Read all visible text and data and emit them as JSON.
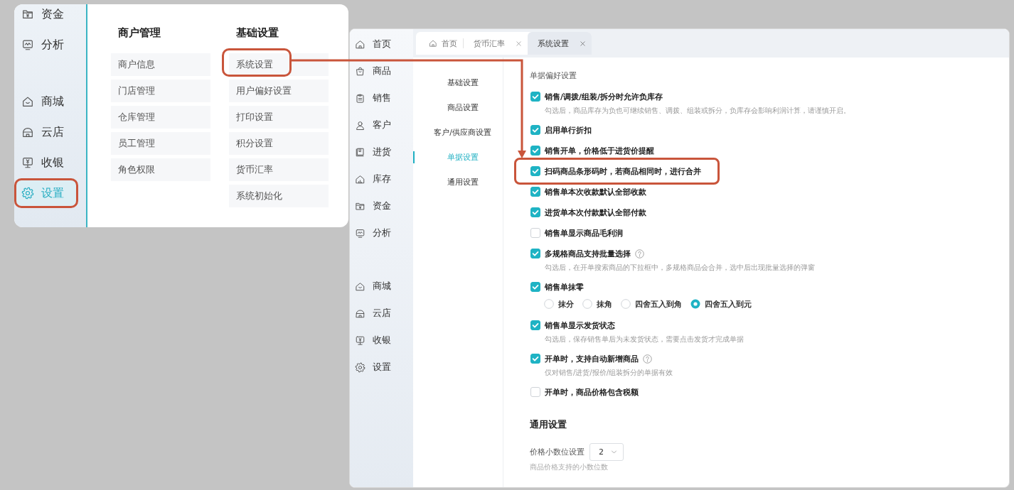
{
  "menu_panel": {
    "sidebar": {
      "groups": [
        {
          "items": [
            {
              "label": "资金",
              "selected": false,
              "highlighted": false
            },
            {
              "label": "分析",
              "selected": false,
              "highlighted": false
            }
          ]
        },
        {
          "items": [
            {
              "label": "商城",
              "selected": false,
              "highlighted": false
            },
            {
              "label": "云店",
              "selected": false,
              "highlighted": false
            },
            {
              "label": "收银",
              "selected": false,
              "highlighted": false
            },
            {
              "label": "设置",
              "selected": true,
              "highlighted": true
            }
          ]
        }
      ]
    },
    "columns": [
      {
        "title": "商户管理",
        "items": [
          {
            "label": "商户信息",
            "highlighted": false
          },
          {
            "label": "门店管理",
            "highlighted": false
          },
          {
            "label": "仓库管理",
            "highlighted": false
          },
          {
            "label": "员工管理",
            "highlighted": false
          },
          {
            "label": "角色权限",
            "highlighted": false
          }
        ]
      },
      {
        "title": "基础设置",
        "items": [
          {
            "label": "系统设置",
            "highlighted": true
          },
          {
            "label": "用户偏好设置",
            "highlighted": false
          },
          {
            "label": "打印设置",
            "highlighted": false
          },
          {
            "label": "积分设置",
            "highlighted": false
          },
          {
            "label": "货币汇率",
            "highlighted": false
          },
          {
            "label": "系统初始化",
            "highlighted": false
          }
        ]
      }
    ]
  },
  "app_window": {
    "sidebar": {
      "groups": [
        {
          "items": [
            {
              "label": "首页",
              "selected": false
            },
            {
              "label": "商品",
              "selected": false
            },
            {
              "label": "销售",
              "selected": false
            },
            {
              "label": "客户",
              "selected": false
            },
            {
              "label": "进货",
              "selected": false
            },
            {
              "label": "库存",
              "selected": false
            },
            {
              "label": "资金",
              "selected": false
            },
            {
              "label": "分析",
              "selected": false
            }
          ]
        },
        {
          "items": [
            {
              "label": "商城",
              "selected": false
            },
            {
              "label": "云店",
              "selected": false
            },
            {
              "label": "收银",
              "selected": false
            },
            {
              "label": "设置",
              "selected": false
            }
          ]
        }
      ]
    },
    "tabs": [
      {
        "label": "首页",
        "kind": "pinned",
        "selected": false
      },
      {
        "label": "货币汇率",
        "kind": "closable",
        "selected": false
      },
      {
        "label": "系统设置",
        "kind": "closable",
        "selected": true
      }
    ],
    "settings_nav": {
      "items": [
        {
          "label": "基础设置",
          "selected": false
        },
        {
          "label": "商品设置",
          "selected": false
        },
        {
          "label": "客户/供应商设置",
          "selected": false
        },
        {
          "label": "单据设置",
          "selected": true
        },
        {
          "label": "通用设置",
          "selected": false
        }
      ]
    },
    "content": {
      "sections": [
        {
          "kind": "options",
          "title": "单据偏好设置",
          "options": [
            {
              "label": "销售/调拨/组装/拆分时允许负库存",
              "checked": true,
              "help": false,
              "highlighted": false,
              "description": "勾选后，商品库存为负也可继续销售、调拨、组装或拆分，负库存会影响利润计算，请谨慎开启。"
            },
            {
              "label": "启用单行折扣",
              "checked": true,
              "help": false,
              "highlighted": false
            },
            {
              "label": "销售开单，价格低于进货价提醒",
              "checked": true,
              "help": false,
              "highlighted": false
            },
            {
              "label": "扫码商品条形码时，若商品相同时，进行合并",
              "checked": true,
              "help": false,
              "highlighted": true
            },
            {
              "label": "销售单本次收款默认全部收款",
              "checked": true,
              "help": false,
              "highlighted": false
            },
            {
              "label": "进货单本次付款默认全部付款",
              "checked": true,
              "help": false,
              "highlighted": false
            },
            {
              "label": "销售单显示商品毛利润",
              "checked": false,
              "help": false,
              "highlighted": false
            },
            {
              "label": "多规格商品支持批量选择",
              "checked": true,
              "help": true,
              "highlighted": false,
              "description": "勾选后，在开单搜索商品的下拉框中，多规格商品会合并，选中后出现批量选择的弹窗"
            },
            {
              "label": "销售单抹零",
              "checked": true,
              "help": false,
              "highlighted": false,
              "choices": [
                {
                  "label": "抹分",
                  "selected": false
                },
                {
                  "label": "抹角",
                  "selected": false
                },
                {
                  "label": "四舍五入到角",
                  "selected": false
                },
                {
                  "label": "四舍五入到元",
                  "selected": true
                }
              ]
            },
            {
              "label": "销售单显示发货状态",
              "checked": true,
              "help": false,
              "highlighted": false,
              "description": "勾选后，保存销售单后为未发货状态，需要点击发货才完成单据"
            },
            {
              "label": "开单时，支持自动新增商品",
              "checked": true,
              "help": true,
              "highlighted": false,
              "description": "仅对销售/进货/报价/组装拆分的单据有效"
            },
            {
              "label": "开单时，商品价格包含税额",
              "checked": false,
              "help": false,
              "highlighted": false
            }
          ]
        },
        {
          "kind": "fields",
          "title": "通用设置",
          "fields": [
            {
              "label": "价格小数位设置",
              "value": "2",
              "hint": "商品价格支持的小数位数"
            }
          ]
        }
      ]
    }
  },
  "callout_arrow": true
}
